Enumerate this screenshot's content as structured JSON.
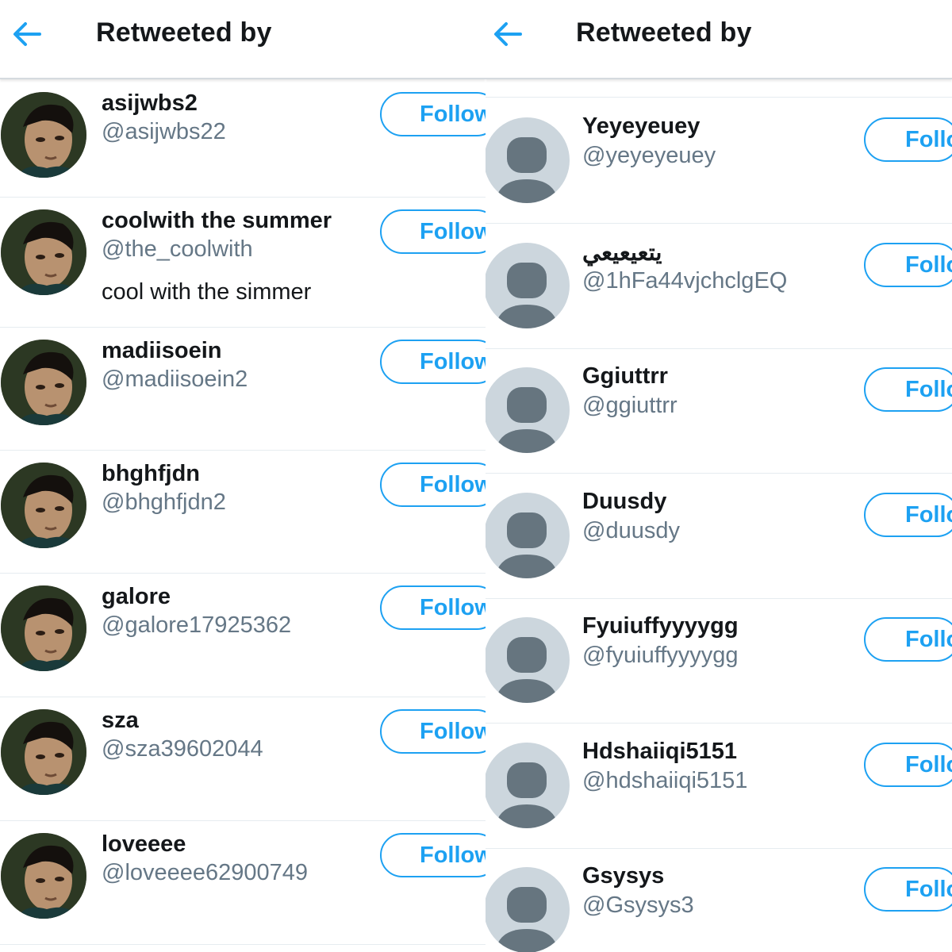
{
  "left_panel": {
    "header_title": "Retweeted by",
    "back_icon": "arrow-left-icon",
    "follow_label": "Follow",
    "users": [
      {
        "name": "asijwbs2",
        "handle": "@asijwbs22",
        "bio": ""
      },
      {
        "name": "coolwith the summer",
        "handle": "@the_coolwith",
        "bio": "cool with the simmer"
      },
      {
        "name": "madiisoein",
        "handle": "@madiisoein2",
        "bio": ""
      },
      {
        "name": "bhghfjdn",
        "handle": "@bhghfjdn2",
        "bio": ""
      },
      {
        "name": "galore",
        "handle": "@galore17925362",
        "bio": ""
      },
      {
        "name": "sza",
        "handle": "@sza39602044",
        "bio": ""
      },
      {
        "name": "loveeee",
        "handle": "@loveeee62900749",
        "bio": ""
      }
    ]
  },
  "right_panel": {
    "header_title": "Retweeted by",
    "back_icon": "arrow-left-icon",
    "follow_label": "Follo",
    "users": [
      {
        "name": "Yeyeyeuey",
        "handle": "@yeyeyeuey"
      },
      {
        "name": "يتعيعيعي",
        "handle": "@1hFa44vjchclgEQ"
      },
      {
        "name": "Ggiuttrr",
        "handle": "@ggiuttrr"
      },
      {
        "name": "Duusdy",
        "handle": "@duusdy"
      },
      {
        "name": "Fyuiuffyyyygg",
        "handle": "@fyuiuffyyyygg"
      },
      {
        "name": "Hdshaiiqi5151",
        "handle": "@hdshaiiqi5151"
      },
      {
        "name": "Gsysys",
        "handle": "@Gsysys3"
      }
    ]
  },
  "colors": {
    "accent": "#1da1f2",
    "handle_gray": "#657786",
    "default_avatar_bg": "#ccd6dd",
    "default_avatar_fg": "#66757f"
  }
}
